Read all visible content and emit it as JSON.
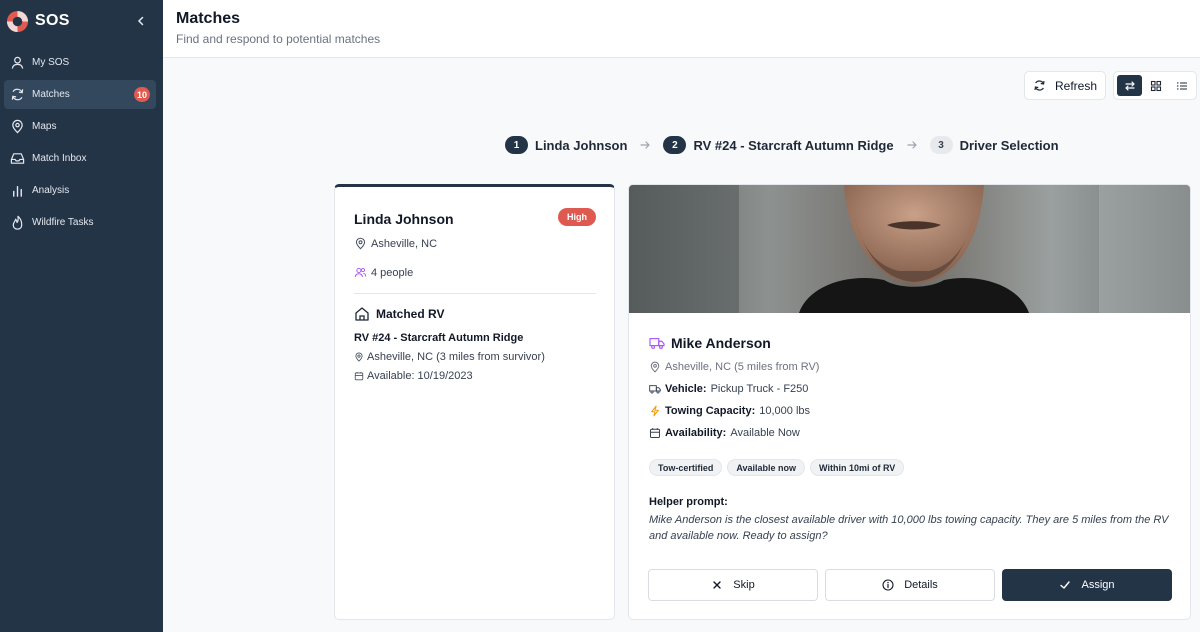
{
  "app": {
    "name": "SOS"
  },
  "sidebar": {
    "items": [
      {
        "label": "My SOS",
        "icon": "user-icon"
      },
      {
        "label": "Matches",
        "icon": "refresh-icon",
        "badge": "10",
        "active": true
      },
      {
        "label": "Maps",
        "icon": "map-pin-icon"
      },
      {
        "label": "Match Inbox",
        "icon": "inbox-icon"
      },
      {
        "label": "Analysis",
        "icon": "bar-chart-icon"
      },
      {
        "label": "Wildfire Tasks",
        "icon": "flame-icon"
      }
    ]
  },
  "header": {
    "title": "Matches",
    "subtitle": "Find and respond to potential matches"
  },
  "toolbar": {
    "refresh_label": "Refresh",
    "view_modes": [
      "swap-view",
      "grid-view",
      "list-view"
    ],
    "active_view": "swap-view"
  },
  "stepper": {
    "steps": [
      {
        "num": "1",
        "label": "Linda Johnson"
      },
      {
        "num": "2",
        "label": "RV #24 - Starcraft Autumn Ridge"
      },
      {
        "num": "3",
        "label": "Driver Selection"
      }
    ]
  },
  "survivor": {
    "name": "Linda Johnson",
    "priority": "High",
    "location": "Asheville, NC",
    "people": "4 people",
    "matched_heading": "Matched RV",
    "rv_name": "RV #24 - Starcraft Autumn Ridge",
    "rv_location": "Asheville, NC (3 miles from survivor)",
    "rv_available": "Available: 10/19/2023"
  },
  "driver": {
    "name": "Mike Anderson",
    "location": "Asheville, NC (5 miles from RV)",
    "vehicle_label": "Vehicle:",
    "vehicle_value": "Pickup Truck - F250",
    "towing_label": "Towing Capacity:",
    "towing_value": "10,000 lbs",
    "availability_label": "Availability:",
    "availability_value": "Available Now",
    "tags": [
      "Tow-certified",
      "Available now",
      "Within 10mi of RV"
    ],
    "helper_label": "Helper prompt:",
    "helper_text": "Mike Anderson is the closest available driver with 10,000 lbs towing capacity. They are 5 miles from the RV and available now. Ready to assign?"
  },
  "actions": {
    "skip": "Skip",
    "details": "Details",
    "assign": "Assign"
  },
  "colors": {
    "sidebar_bg": "#243447",
    "accent": "#243447",
    "badge": "#e05a4f",
    "priority_high": "#de5a50"
  }
}
